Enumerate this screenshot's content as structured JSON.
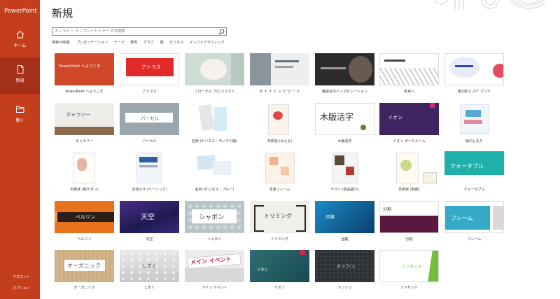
{
  "app": {
    "title": "PowerPoint"
  },
  "sidebar": {
    "items": [
      {
        "label": "ホーム"
      },
      {
        "label": "新規"
      },
      {
        "label": "開く"
      }
    ],
    "footer": [
      {
        "label": "アカウント"
      },
      {
        "label": "オプション"
      }
    ]
  },
  "header": {
    "title": "新規",
    "search_placeholder": "オンライン テンプレートとテーマの検索",
    "suggest_lead": "検索の候補:",
    "suggestions": [
      "プレゼンテーション",
      "テーマ",
      "教育",
      "グラフ",
      "図",
      "ビジネス",
      "インフォグラフィック"
    ]
  },
  "templates": [
    {
      "caption": "PowerPoint へようこそ",
      "title": "PowerPoint へようこそ"
    },
    {
      "caption": "アトラス",
      "title": "アトラス"
    },
    {
      "caption": "フローラル プロ ジェクト",
      "title": ""
    },
    {
      "caption": "ダ イ ナ ミ ッ ク ワ ー ク",
      "title": ""
    },
    {
      "caption": "機会社のインスピレーション",
      "title": ""
    },
    {
      "caption": "未来へ",
      "title": ""
    },
    {
      "caption": "紙の町とスケ ブック",
      "title": ""
    },
    {
      "caption": "ギャラリー",
      "title": "ギャラリー"
    },
    {
      "caption": "パーセル",
      "title": "パーセル"
    },
    {
      "caption": "名刺 (ビジネス・モノクロ版)",
      "title": ""
    },
    {
      "caption": "年賀状 (かえる)",
      "title": ""
    },
    {
      "caption": "木版活字",
      "title": "木版活字"
    },
    {
      "caption": "イオン ボードルーム",
      "title": "イオン"
    },
    {
      "caption": "絵のしおり",
      "title": ""
    },
    {
      "caption": "年賀状 (和モダン)",
      "title": ""
    },
    {
      "caption": "お知らせ (ベーシック)",
      "title": ""
    },
    {
      "caption": "名刺 (ビジネス・ブルー)",
      "title": ""
    },
    {
      "caption": "写真フレーム",
      "title": ""
    },
    {
      "caption": "チラシ (商品紹介)",
      "title": ""
    },
    {
      "caption": "年賀状 (和紙)",
      "title": ""
    },
    {
      "caption": "クォータブル",
      "title": "クォータブル"
    },
    {
      "caption": "ベルリン",
      "title": "ベルリン"
    },
    {
      "caption": "天空",
      "title": "天空"
    },
    {
      "caption": "シャボン",
      "title": "シャボン"
    },
    {
      "caption": "トリミング",
      "title": "トリミング"
    },
    {
      "caption": "回路",
      "title": "回路"
    },
    {
      "caption": "分割",
      "title": "分割"
    },
    {
      "caption": "フレーム",
      "title": "フレーム"
    },
    {
      "caption": "オーガニック",
      "title": "オーガニック"
    },
    {
      "caption": "しずく",
      "title": "しずく"
    },
    {
      "caption": "メイン イベント",
      "title": "メイン イベント"
    },
    {
      "caption": "イオン",
      "title": "イオン"
    },
    {
      "caption": "メッシュ",
      "title": "メッシュ"
    },
    {
      "caption": "ファセット",
      "title": "ファセット"
    }
  ]
}
